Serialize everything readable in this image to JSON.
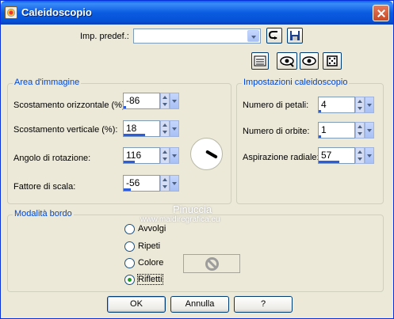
{
  "window": {
    "title": "Caleidoscopio"
  },
  "preset": {
    "label": "Imp. predef.:",
    "value": ""
  },
  "image_area": {
    "title": "Area d'immagine",
    "horizontal_offset": {
      "label": "Scostamento orizzontale (%):",
      "value": "-86",
      "level": 0.07
    },
    "vertical_offset": {
      "label": "Scostamento verticale (%):",
      "value": "18",
      "level": 0.59
    },
    "rotation_angle": {
      "label": "Angolo di rotazione:",
      "value": "116",
      "level": 0.32
    },
    "scale_factor": {
      "label": "Fattore di scala:",
      "value": "-56",
      "level": 0.2
    }
  },
  "kaleidoscope_settings": {
    "title": "Impostazioni caleidoscopio",
    "petals": {
      "label": "Numero di petali:",
      "value": "4",
      "level": 0.04
    },
    "orbits": {
      "label": "Numero di orbite:",
      "value": "1",
      "level": 0.02
    },
    "radial_suction": {
      "label": "Aspirazione radiale:",
      "value": "57",
      "level": 0.57
    }
  },
  "edge_mode": {
    "title": "Modalità bordo",
    "options": [
      "Avvolgi",
      "Ripeti",
      "Colore",
      "Rifletti"
    ],
    "selected": "Rifletti"
  },
  "watermark": {
    "name": "Pinuccia",
    "url": "www.maidiregrafica.eu"
  },
  "buttons": {
    "ok": "OK",
    "cancel": "Annulla",
    "help": "?"
  },
  "colors": {
    "title_bar": "#0A5FE8",
    "group_title": "#0046D5",
    "face": "#ECE9D8",
    "spin_bar": "#2E5BD7"
  }
}
